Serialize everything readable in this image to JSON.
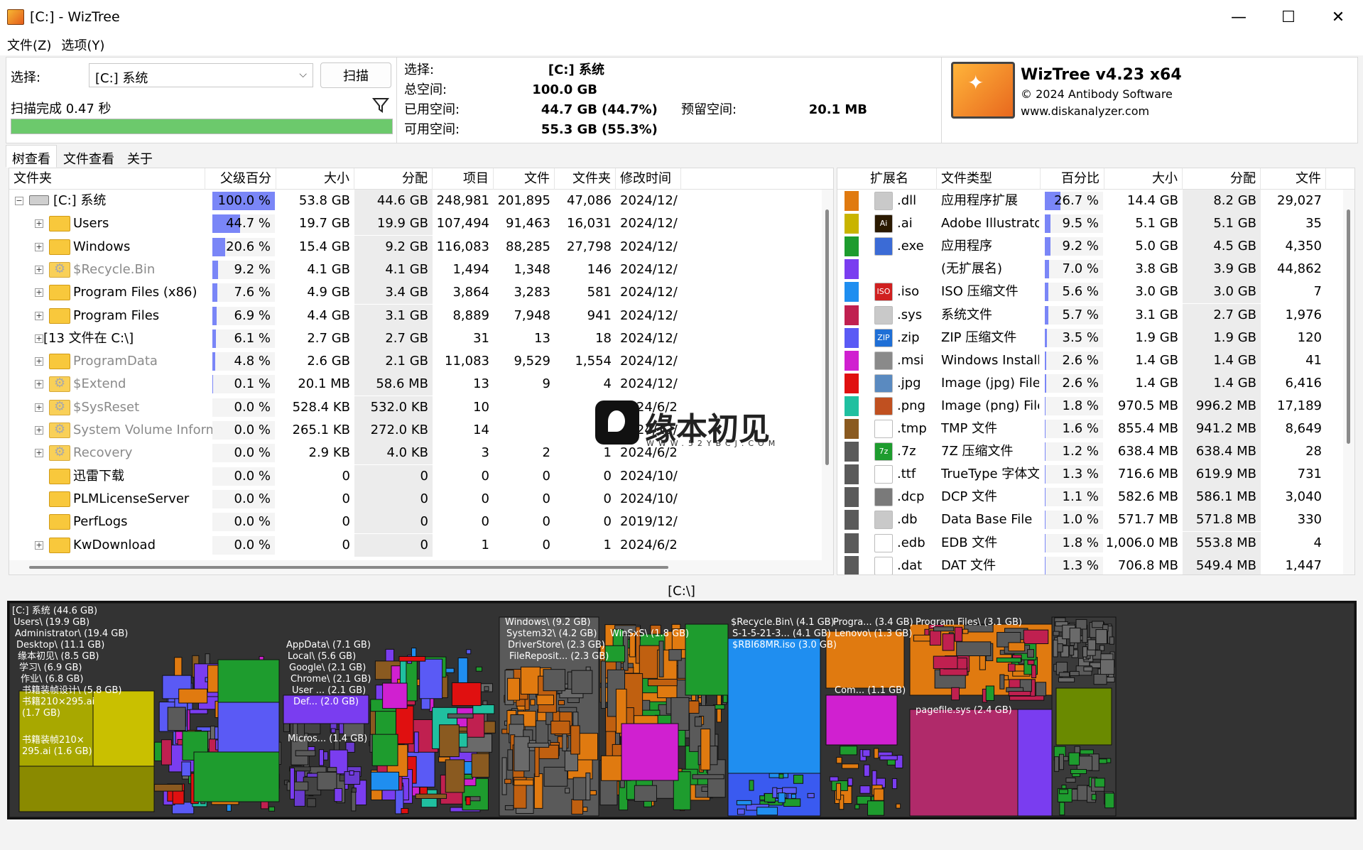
{
  "window": {
    "title": "[C:]  - WizTree",
    "min": "—",
    "max": "☐",
    "close": "✕"
  },
  "menu": [
    "文件(Z)",
    "选项(Y)"
  ],
  "select": {
    "label": "选择:",
    "value": "[C:] 系统",
    "scan_button": "扫描",
    "status": "扫描完成 0.47 秒",
    "progress": 1.0
  },
  "info": {
    "select_label": "选择:",
    "select_value": "[C:]  系统",
    "total_label": "总空间:",
    "total_value": "100.0 GB",
    "used_label": "已用空间:",
    "used_value": "44.7 GB",
    "used_pct": "(44.7%)",
    "free_label": "可用空间:",
    "free_value": "55.3 GB",
    "free_pct": "(55.3%)",
    "reserved_label": "预留空间:",
    "reserved_value": "20.1 MB"
  },
  "brand": {
    "name": "WizTree v4.23 x64",
    "copyright": "© 2024 Antibody Software",
    "site": "www.diskanalyzer.com"
  },
  "tabs": [
    "树查看",
    "文件查看",
    "关于"
  ],
  "tree": {
    "headers": [
      "文件夹",
      "父级百分比",
      "大小",
      "分配",
      "项目",
      "文件",
      "文件夹",
      "修改时间"
    ],
    "rows": [
      {
        "name": "[C:] 系统",
        "pct": "100.0 %",
        "p": 1.0,
        "size": "53.8 GB",
        "alloc": "44.6 GB",
        "items": "248,981",
        "files": "201,895",
        "folders": "47,086",
        "mod": "2024/12/",
        "icon": "drive",
        "level": 0,
        "gray": false
      },
      {
        "name": "Users",
        "pct": "44.7 %",
        "p": 0.447,
        "size": "19.7 GB",
        "alloc": "19.9 GB",
        "items": "107,494",
        "files": "91,463",
        "folders": "16,031",
        "mod": "2024/12/",
        "icon": "folder",
        "level": 1,
        "gray": false
      },
      {
        "name": "Windows",
        "pct": "20.6 %",
        "p": 0.206,
        "size": "15.4 GB",
        "alloc": "9.2 GB",
        "items": "116,083",
        "files": "88,285",
        "folders": "27,798",
        "mod": "2024/12/",
        "icon": "folder",
        "level": 1,
        "gray": false
      },
      {
        "name": "$Recycle.Bin",
        "pct": "9.2 %",
        "p": 0.092,
        "size": "4.1 GB",
        "alloc": "4.1 GB",
        "items": "1,494",
        "files": "1,348",
        "folders": "146",
        "mod": "2024/12/",
        "icon": "gear",
        "level": 1,
        "gray": true
      },
      {
        "name": "Program Files (x86)",
        "pct": "7.6 %",
        "p": 0.076,
        "size": "4.9 GB",
        "alloc": "3.4 GB",
        "items": "3,864",
        "files": "3,283",
        "folders": "581",
        "mod": "2024/12/",
        "icon": "folder",
        "level": 1,
        "gray": false
      },
      {
        "name": "Program Files",
        "pct": "6.9 %",
        "p": 0.069,
        "size": "4.4 GB",
        "alloc": "3.1 GB",
        "items": "8,889",
        "files": "7,948",
        "folders": "941",
        "mod": "2024/12/",
        "icon": "folder",
        "level": 1,
        "gray": false
      },
      {
        "name": "[13 文件在 C:\\]",
        "pct": "6.1 %",
        "p": 0.061,
        "size": "2.7 GB",
        "alloc": "2.7 GB",
        "items": "31",
        "files": "13",
        "folders": "18",
        "mod": "2024/12/",
        "icon": "none",
        "level": 1,
        "gray": false
      },
      {
        "name": "ProgramData",
        "pct": "4.8 %",
        "p": 0.048,
        "size": "2.6 GB",
        "alloc": "2.1 GB",
        "items": "11,083",
        "files": "9,529",
        "folders": "1,554",
        "mod": "2024/12/",
        "icon": "folder",
        "level": 1,
        "gray": true
      },
      {
        "name": "$Extend",
        "pct": "0.1 %",
        "p": 0.001,
        "size": "20.1 MB",
        "alloc": "58.6 MB",
        "items": "13",
        "files": "9",
        "folders": "4",
        "mod": "2024/12/",
        "icon": "gear",
        "level": 1,
        "gray": true
      },
      {
        "name": "$SysReset",
        "pct": "0.0 %",
        "p": 0,
        "size": "528.4 KB",
        "alloc": "532.0 KB",
        "items": "10",
        "files": "",
        "folders": "",
        "mod": "2024/6/2",
        "icon": "gear",
        "level": 1,
        "gray": true
      },
      {
        "name": "System Volume Information",
        "pct": "0.0 %",
        "p": 0,
        "size": "265.1 KB",
        "alloc": "272.0 KB",
        "items": "14",
        "files": "",
        "folders": "",
        "mod": "2024/12/",
        "icon": "gear",
        "level": 1,
        "gray": true
      },
      {
        "name": "Recovery",
        "pct": "0.0 %",
        "p": 0,
        "size": "2.9 KB",
        "alloc": "4.0 KB",
        "items": "3",
        "files": "2",
        "folders": "1",
        "mod": "2024/6/2",
        "icon": "gear",
        "level": 1,
        "gray": true
      },
      {
        "name": "迅雷下载",
        "pct": "0.0 %",
        "p": 0,
        "size": "0",
        "alloc": "0",
        "items": "0",
        "files": "0",
        "folders": "0",
        "mod": "2024/10/",
        "icon": "folder",
        "level": 1,
        "gray": false,
        "noexp": true
      },
      {
        "name": "PLMLicenseServer",
        "pct": "0.0 %",
        "p": 0,
        "size": "0",
        "alloc": "0",
        "items": "0",
        "files": "0",
        "folders": "0",
        "mod": "2024/10/",
        "icon": "folder",
        "level": 1,
        "gray": false,
        "noexp": true
      },
      {
        "name": "PerfLogs",
        "pct": "0.0 %",
        "p": 0,
        "size": "0",
        "alloc": "0",
        "items": "0",
        "files": "0",
        "folders": "0",
        "mod": "2019/12/",
        "icon": "folder",
        "level": 1,
        "gray": false,
        "noexp": true
      },
      {
        "name": "KwDownload",
        "pct": "0.0 %",
        "p": 0,
        "size": "0",
        "alloc": "0",
        "items": "1",
        "files": "0",
        "folders": "1",
        "mod": "2024/6/2",
        "icon": "folder",
        "level": 1,
        "gray": false
      }
    ]
  },
  "ext": {
    "headers": [
      "扩展名",
      "文件类型",
      "百分比",
      "大小",
      "分配",
      "文件"
    ],
    "rows": [
      {
        "color": "#e07a10",
        "ext": ".dll",
        "type": "应用程序扩展",
        "pct": "26.7 %",
        "p": 0.267,
        "size": "14.4 GB",
        "alloc": "8.2 GB",
        "files": "29,027",
        "icon": "#c9c9c9",
        "ic": ""
      },
      {
        "color": "#c9b400",
        "ext": ".ai",
        "type": "Adobe Illustrator",
        "pct": "9.5 %",
        "p": 0.095,
        "size": "5.1 GB",
        "alloc": "5.1 GB",
        "files": "35",
        "icon": "#2b1a00",
        "ic": "Ai"
      },
      {
        "color": "#1e9c2e",
        "ext": ".exe",
        "type": "应用程序",
        "pct": "9.2 %",
        "p": 0.092,
        "size": "5.0 GB",
        "alloc": "4.5 GB",
        "files": "4,350",
        "icon": "#3b6bd6",
        "ic": ""
      },
      {
        "color": "#7a3df0",
        "ext": "",
        "type": "(无扩展名)",
        "pct": "7.0 %",
        "p": 0.07,
        "size": "3.8 GB",
        "alloc": "3.9 GB",
        "files": "44,862",
        "icon": "none",
        "ic": ""
      },
      {
        "color": "#1f8ef0",
        "ext": ".iso",
        "type": "ISO 压缩文件",
        "pct": "5.6 %",
        "p": 0.056,
        "size": "3.0 GB",
        "alloc": "3.0 GB",
        "files": "7",
        "icon": "#d02020",
        "ic": "ISO"
      },
      {
        "color": "#c02050",
        "ext": ".sys",
        "type": "系统文件",
        "pct": "5.7 %",
        "p": 0.057,
        "size": "3.1 GB",
        "alloc": "2.7 GB",
        "files": "1,976",
        "icon": "#c9c9c9",
        "ic": ""
      },
      {
        "color": "#5a5af5",
        "ext": ".zip",
        "type": "ZIP 压缩文件",
        "pct": "3.5 %",
        "p": 0.035,
        "size": "1.9 GB",
        "alloc": "1.9 GB",
        "files": "120",
        "icon": "#1f6fd6",
        "ic": "ZIP"
      },
      {
        "color": "#d020d0",
        "ext": ".msi",
        "type": "Windows Installe",
        "pct": "2.6 %",
        "p": 0.026,
        "size": "1.4 GB",
        "alloc": "1.4 GB",
        "files": "41",
        "icon": "#8a8a8a",
        "ic": ""
      },
      {
        "color": "#e01010",
        "ext": ".jpg",
        "type": "Image (jpg) File",
        "pct": "2.6 %",
        "p": 0.026,
        "size": "1.4 GB",
        "alloc": "1.4 GB",
        "files": "6,416",
        "icon": "#5a8ac0",
        "ic": ""
      },
      {
        "color": "#20c0a0",
        "ext": ".png",
        "type": "Image (png) File",
        "pct": "1.8 %",
        "p": 0.018,
        "size": "970.5 MB",
        "alloc": "996.2 MB",
        "files": "17,189",
        "icon": "#c05020",
        "ic": ""
      },
      {
        "color": "#8a5a20",
        "ext": ".tmp",
        "type": "TMP 文件",
        "pct": "1.6 %",
        "p": 0.016,
        "size": "855.4 MB",
        "alloc": "941.2 MB",
        "files": "8,649",
        "icon": "#ffffff",
        "ic": ""
      },
      {
        "color": "#5a5a5a",
        "ext": ".7z",
        "type": "7Z 压缩文件",
        "pct": "1.2 %",
        "p": 0.012,
        "size": "638.4 MB",
        "alloc": "638.4 MB",
        "files": "28",
        "icon": "#1e9c2e",
        "ic": "7z"
      },
      {
        "color": "#5a5a5a",
        "ext": ".ttf",
        "type": "TrueType 字体文",
        "pct": "1.3 %",
        "p": 0.013,
        "size": "716.6 MB",
        "alloc": "619.9 MB",
        "files": "731",
        "icon": "#ffffff",
        "ic": ""
      },
      {
        "color": "#5a5a5a",
        "ext": ".dcp",
        "type": "DCP 文件",
        "pct": "1.1 %",
        "p": 0.011,
        "size": "582.6 MB",
        "alloc": "586.1 MB",
        "files": "3,040",
        "icon": "#7a7a7a",
        "ic": ""
      },
      {
        "color": "#5a5a5a",
        "ext": ".db",
        "type": "Data Base File",
        "pct": "1.0 %",
        "p": 0.01,
        "size": "571.7 MB",
        "alloc": "571.8 MB",
        "files": "330",
        "icon": "#c9c9c9",
        "ic": ""
      },
      {
        "color": "#5a5a5a",
        "ext": ".edb",
        "type": "EDB 文件",
        "pct": "1.8 %",
        "p": 0.018,
        "size": "1,006.0 MB",
        "alloc": "553.8 MB",
        "files": "4",
        "icon": "#ffffff",
        "ic": ""
      },
      {
        "color": "#5a5a5a",
        "ext": ".dat",
        "type": "DAT 文件",
        "pct": "1.3 %",
        "p": 0.013,
        "size": "706.8 MB",
        "alloc": "549.4 MB",
        "files": "1,447",
        "icon": "#ffffff",
        "ic": ""
      }
    ]
  },
  "path": "[C:\\]",
  "treemap": {
    "labels": [
      "[C:] 系统  (44.6 GB)",
      "Users\\ (19.9 GB)",
      "Administrator\\ (19.4 GB)",
      "Desktop\\ (11.1 GB)",
      "缘本初见\\ (8.5 GB)",
      "学习\\ (6.9 GB)",
      "作业\\ (6.8 GB)",
      "书籍装帧设计\\ (5.8 GB)",
      "书籍210×295.ai",
      "(1.7 GB)",
      "书籍装帧210×",
      "295.ai (1.6 GB)",
      "AppData\\ (7.1 GB)",
      "Local\\ (5.6 GB)",
      "Google\\ (2.1 GB)",
      "Chrome\\ (2.1 GB)",
      "User ... (2.1 GB)",
      "Def... (2.0 GB)",
      "Micros... (1.4 GB)",
      "Windows\\ (9.2 GB)",
      "System32\\ (4.2 GB)",
      "DriverStore\\ (2.3 GB)",
      "FileReposit... (2.3 GB)",
      "WinSxS\\ (1.8 GB)",
      "$Recycle.Bin\\ (4.1 GB)",
      "S-1-5-21-3... (4.1 GB)",
      "$RBI68MR.iso (3.0 GB)",
      "Progra... (3.4 GB)",
      "Lenovo\\ (1.3 GB)",
      "Com... (1.1 GB)",
      "Program Files\\ (3.1 GB)",
      "pagefile.sys (2.4 GB)"
    ]
  },
  "watermark": {
    "text": "缘本初见",
    "sub": "WWW.52YBCJ.COM"
  },
  "colors": {
    "bar": "#7a86f7",
    "progress": "#6cc96c"
  }
}
